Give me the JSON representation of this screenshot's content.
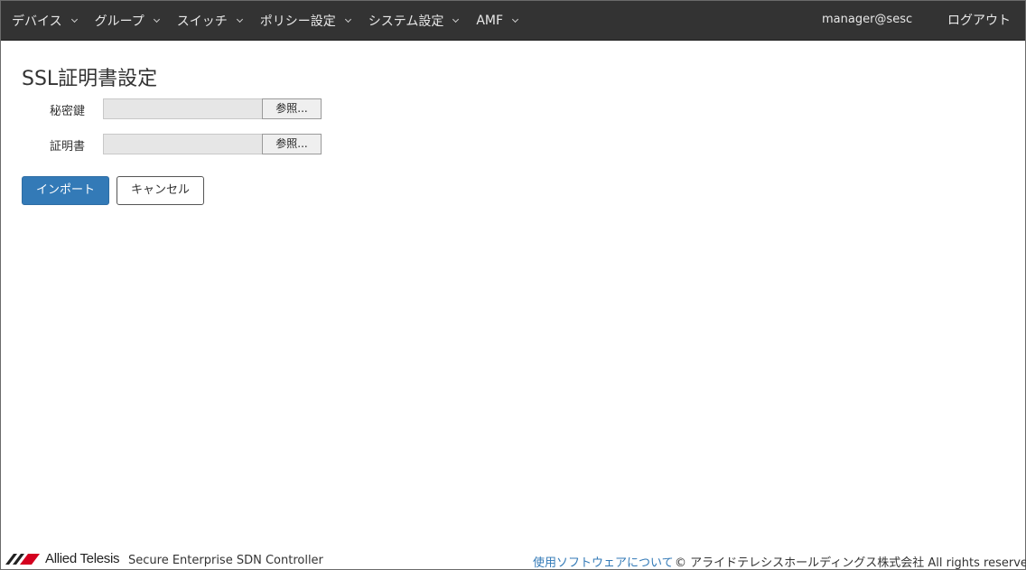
{
  "navbar": {
    "menu": [
      {
        "label": "デバイス"
      },
      {
        "label": "グループ"
      },
      {
        "label": "スイッチ"
      },
      {
        "label": "ポリシー設定"
      },
      {
        "label": "システム設定"
      },
      {
        "label": "AMF"
      }
    ],
    "user": "manager@sesc",
    "logout": "ログアウト"
  },
  "page": {
    "title": "SSL証明書設定",
    "fields": [
      {
        "label": "秘密鍵",
        "value": "",
        "browse_label": "参照..."
      },
      {
        "label": "証明書",
        "value": "",
        "browse_label": "参照..."
      }
    ],
    "import_label": "インポート",
    "cancel_label": "キャンセル"
  },
  "footer": {
    "logo_text": "Allied Telesis",
    "product": "Secure Enterprise SDN Controller",
    "link": "使用ソフトウェアについて",
    "copyright": "© アライドテレシスホールディングス株式会社 All rights reserved."
  },
  "colors": {
    "navbar_bg": "#333333",
    "primary": "#337ab7",
    "logo_red": "#d4001f"
  }
}
